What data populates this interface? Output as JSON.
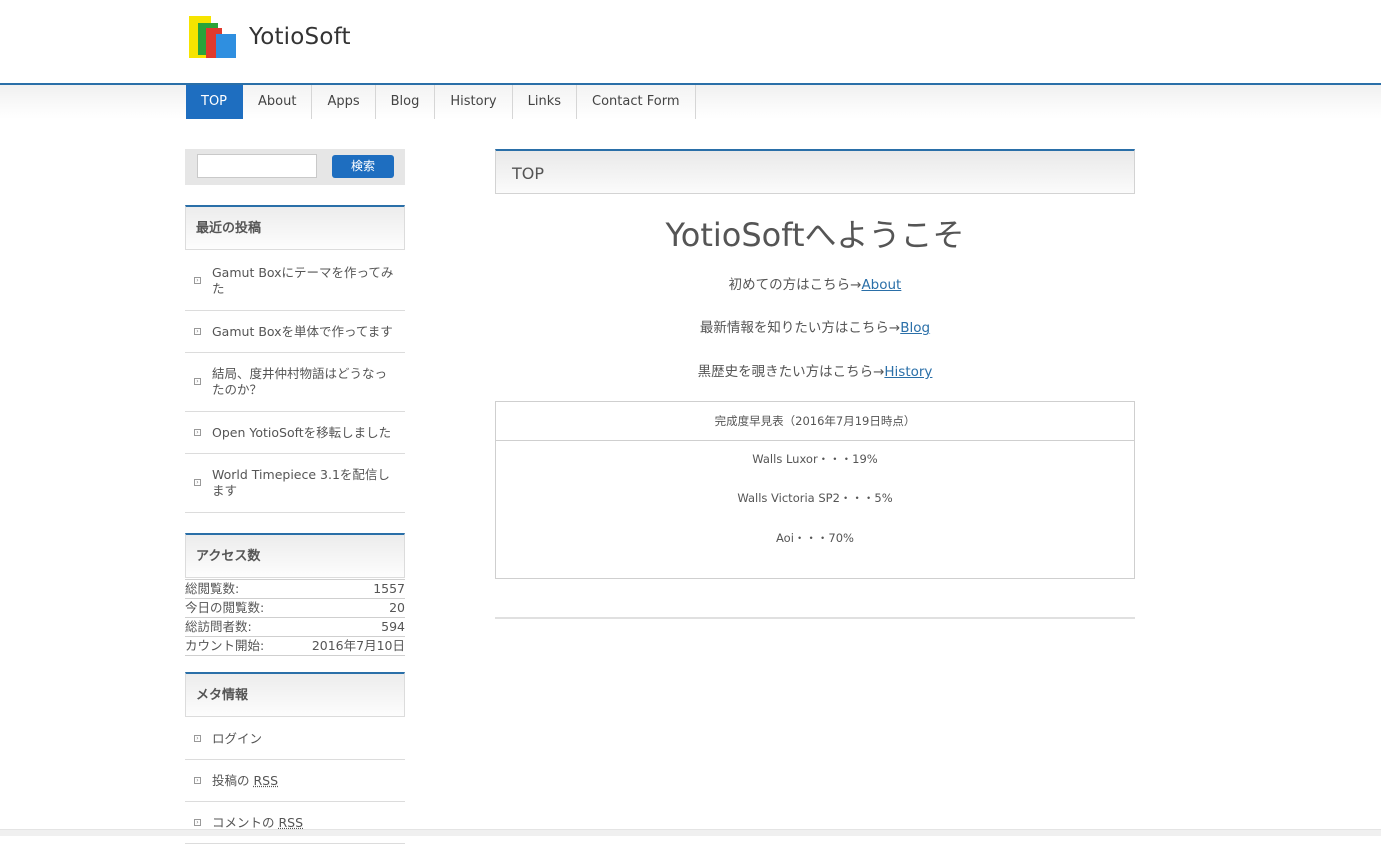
{
  "site": {
    "title": "YotioSoft"
  },
  "nav": {
    "items": [
      {
        "label": "TOP"
      },
      {
        "label": "About"
      },
      {
        "label": "Apps"
      },
      {
        "label": "Blog"
      },
      {
        "label": "History"
      },
      {
        "label": "Links"
      },
      {
        "label": "Contact Form"
      }
    ]
  },
  "search": {
    "value": "",
    "button_label": "検索"
  },
  "recent_posts": {
    "title": "最近の投稿",
    "items": [
      {
        "label": "Gamut Boxにテーマを作ってみた"
      },
      {
        "label": "Gamut Boxを単体で作ってます"
      },
      {
        "label": "結局、度井仲村物語はどうなったのか？"
      },
      {
        "label": "Open YotioSoftを移転しました"
      },
      {
        "label": "World Timepiece 3.1を配信します"
      }
    ]
  },
  "access": {
    "title": "アクセス数",
    "rows": [
      {
        "label": "総閲覧数:",
        "value": "1557"
      },
      {
        "label": "今日の閲覧数:",
        "value": "20"
      },
      {
        "label": "総訪問者数:",
        "value": "594"
      },
      {
        "label": "カウント開始:",
        "value": "2016年7月10日"
      }
    ]
  },
  "meta": {
    "title": "メタ情報",
    "items": [
      {
        "label": "ログイン"
      },
      {
        "prefix": "投稿の ",
        "link": "RSS"
      },
      {
        "prefix": "コメントの ",
        "link": "RSS"
      }
    ]
  },
  "main": {
    "page_title": "TOP",
    "welcome": "YotioSoftへようこそ",
    "lines": [
      {
        "text": "初めての方はこちら→",
        "link": "About"
      },
      {
        "text": "最新情報を知りたい方はこちら→",
        "link": "Blog"
      },
      {
        "text": "黒歴史を覗きたい方はこちら→",
        "link": "History"
      }
    ],
    "table": {
      "header": "完成度早見表（2016年7月19日時点）",
      "rows": [
        {
          "text": "Walls Luxor・・・19%"
        },
        {
          "text": "Walls Victoria SP2・・・5%"
        },
        {
          "text": "Aoi・・・70%"
        }
      ]
    }
  }
}
